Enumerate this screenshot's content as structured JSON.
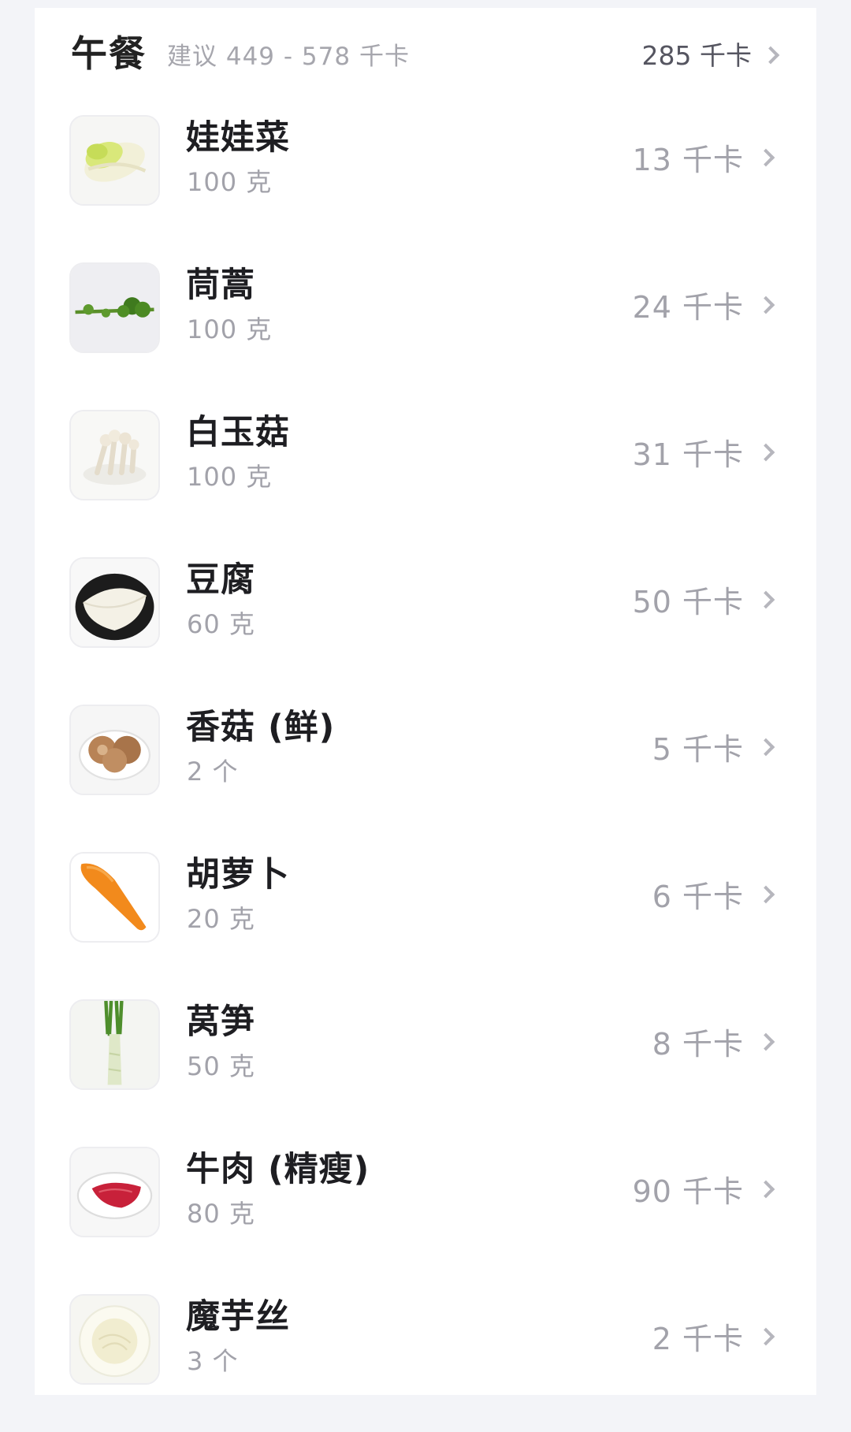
{
  "meal": {
    "title": "午餐",
    "suggestion": "建议 449 - 578 千卡",
    "total": "285 千卡"
  },
  "items": [
    {
      "name": "娃娃菜",
      "qty": "100 克",
      "kcal": "13 千卡",
      "icon": "baby-cabbage-icon"
    },
    {
      "name": "茼蒿",
      "qty": "100 克",
      "kcal": "24 千卡",
      "icon": "crown-daisy-icon"
    },
    {
      "name": "白玉菇",
      "qty": "100 克",
      "kcal": "31 千卡",
      "icon": "white-mushroom-icon"
    },
    {
      "name": "豆腐",
      "qty": "60 克",
      "kcal": "50 千卡",
      "icon": "tofu-icon"
    },
    {
      "name": "香菇 (鲜)",
      "qty": "2 个",
      "kcal": "5 千卡",
      "icon": "shiitake-icon"
    },
    {
      "name": "胡萝卜",
      "qty": "20 克",
      "kcal": "6 千卡",
      "icon": "carrot-icon"
    },
    {
      "name": "莴笋",
      "qty": "50 克",
      "kcal": "8 千卡",
      "icon": "lettuce-stem-icon"
    },
    {
      "name": "牛肉 (精瘦)",
      "qty": "80 克",
      "kcal": "90 千卡",
      "icon": "beef-icon"
    },
    {
      "name": "魔芋丝",
      "qty": "3 个",
      "kcal": "2 千卡",
      "icon": "konjac-noodle-icon"
    }
  ],
  "colors": {
    "background": "#f3f4f8",
    "card": "#ffffff",
    "title": "#222222",
    "muted": "#a2a2aa",
    "chevron": "#b6b6bd"
  }
}
